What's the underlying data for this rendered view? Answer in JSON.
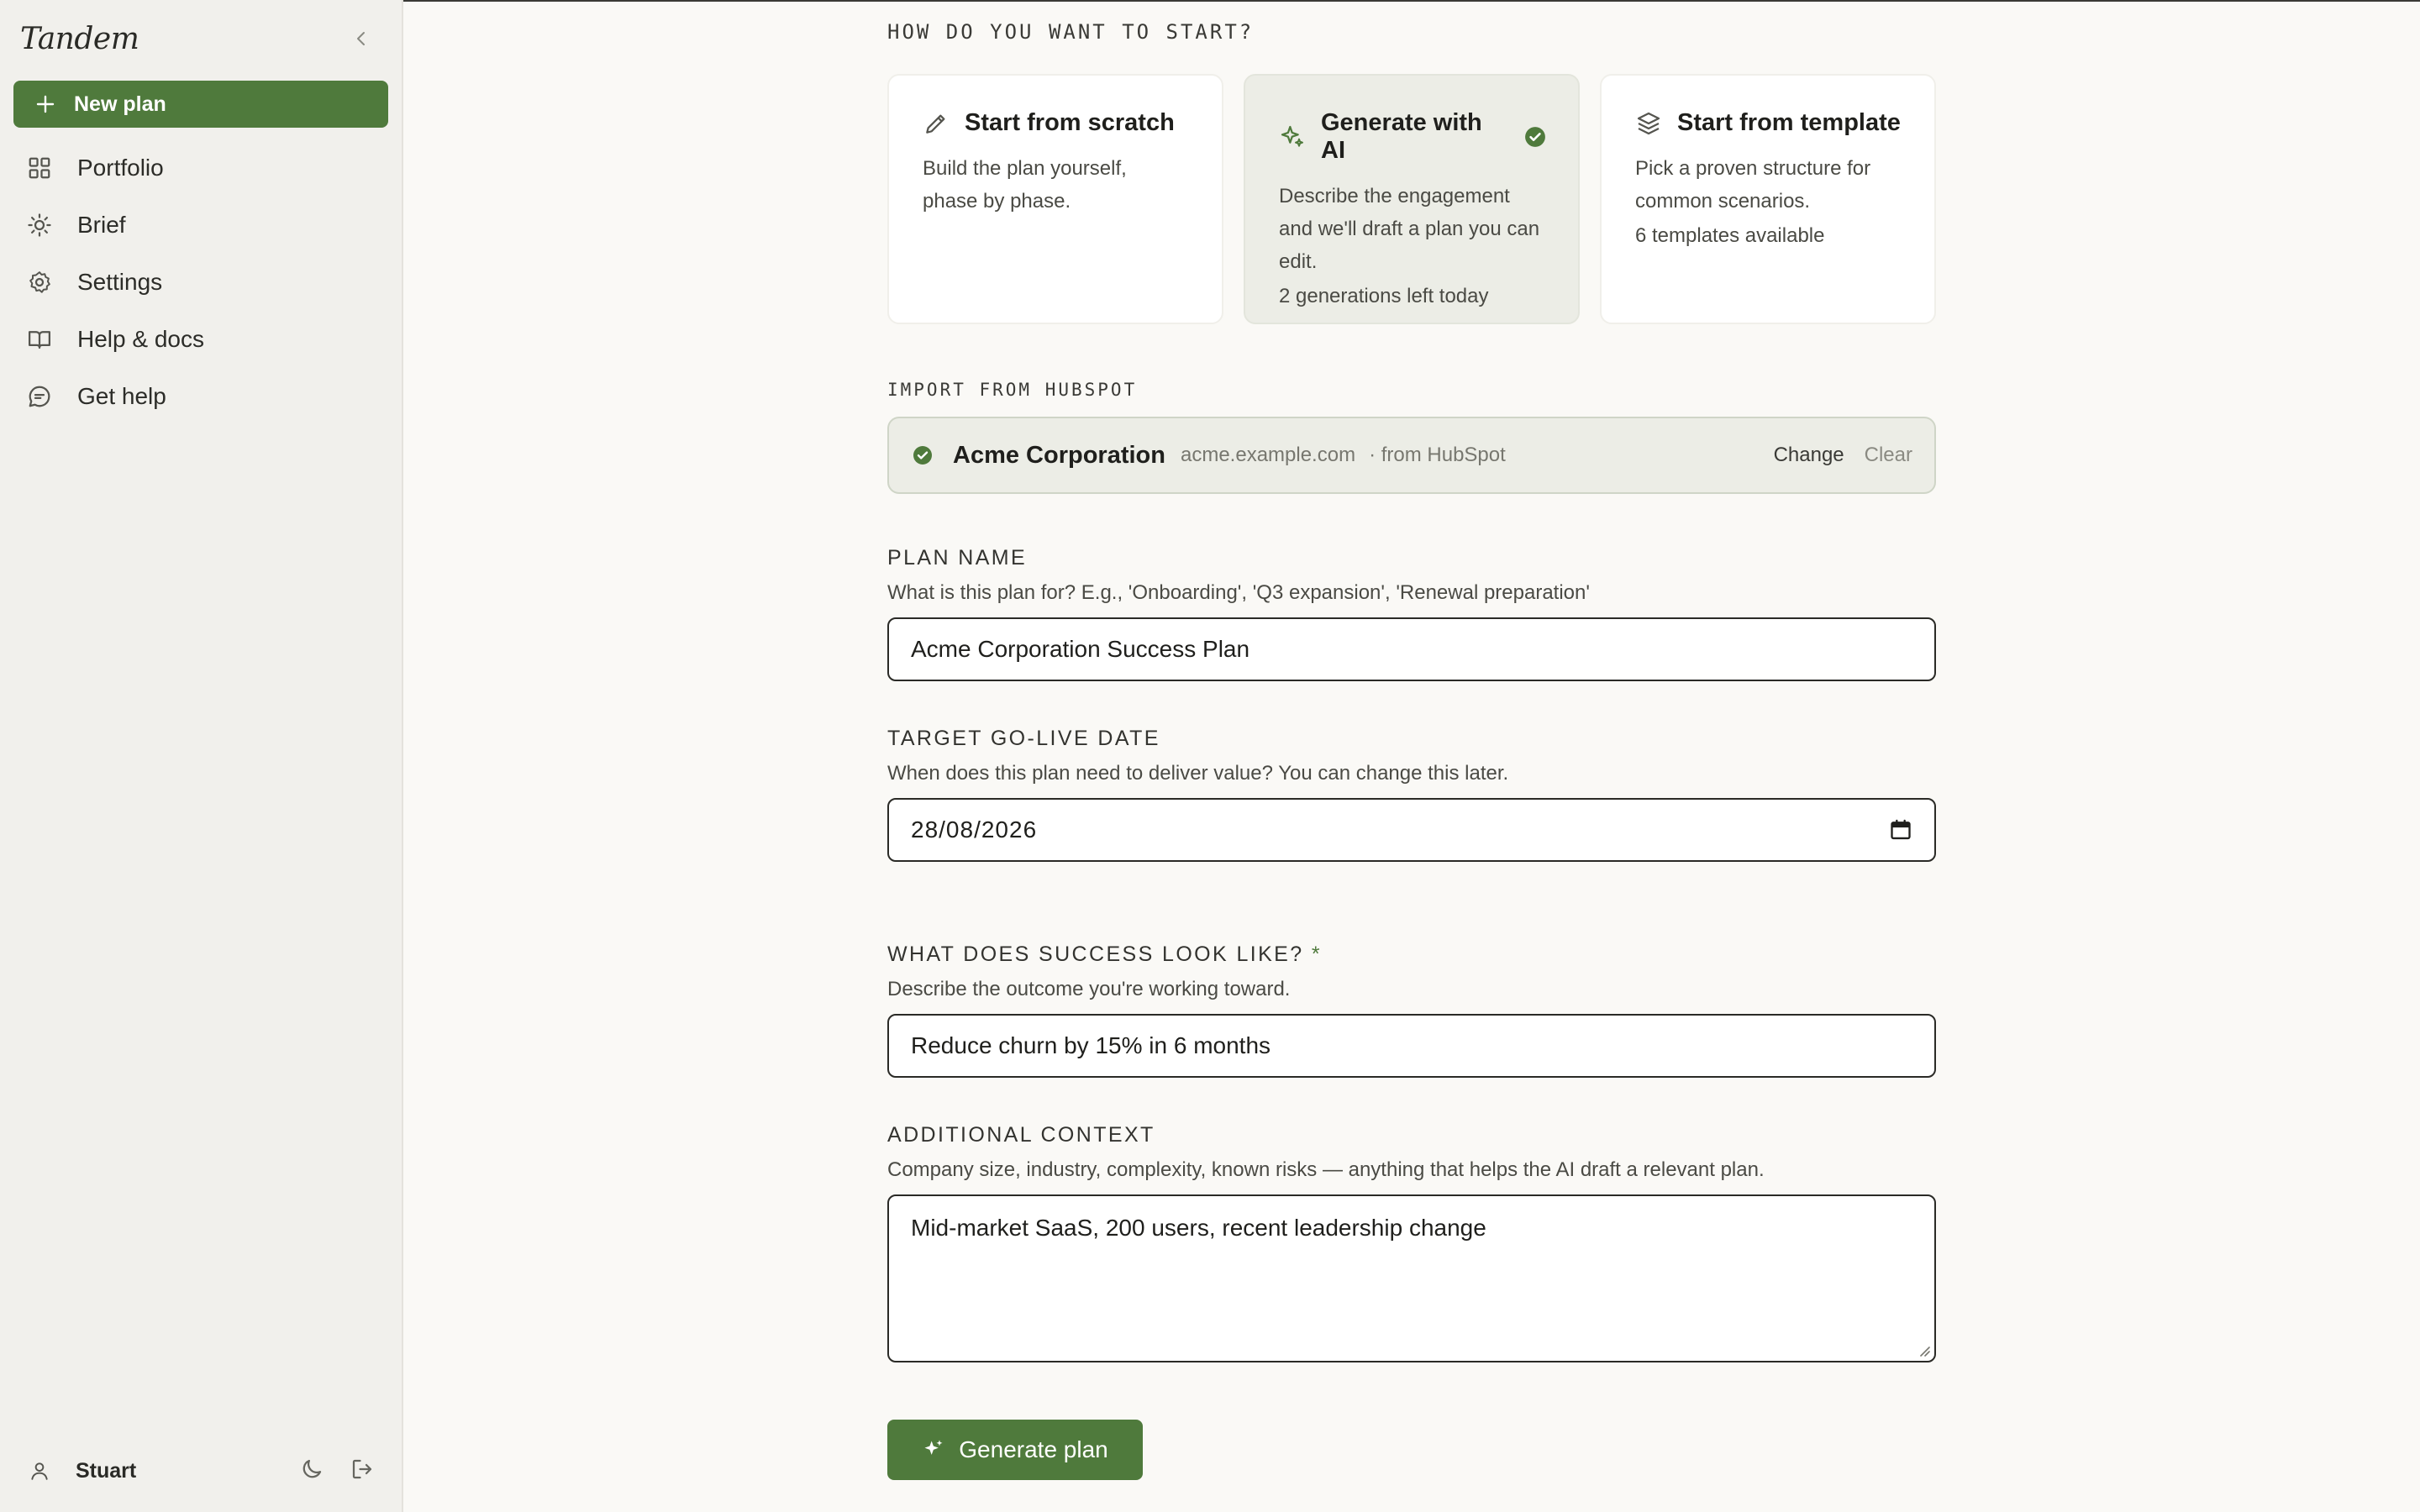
{
  "app": {
    "brand": "Tandem"
  },
  "sidebar": {
    "new_plan_label": "New plan",
    "items": [
      {
        "label": "Portfolio",
        "icon": "grid-icon"
      },
      {
        "label": "Brief",
        "icon": "sun-icon"
      },
      {
        "label": "Settings",
        "icon": "gear-icon"
      },
      {
        "label": "Help & docs",
        "icon": "book-icon"
      },
      {
        "label": "Get help",
        "icon": "chat-icon"
      }
    ],
    "user": {
      "name": "Stuart"
    }
  },
  "start": {
    "label": "HOW DO YOU WANT TO START?",
    "cards": [
      {
        "title": "Start from scratch",
        "desc": "Build the plan yourself, phase by phase.",
        "meta": "",
        "icon": "pencil-icon"
      },
      {
        "title": "Generate with AI",
        "desc": "Describe the engagement and we'll draft a plan you can edit.",
        "meta": "2 generations left today",
        "icon": "sparkle-icon",
        "selected": true
      },
      {
        "title": "Start from template",
        "desc": "Pick a proven structure for common scenarios.",
        "meta": "6 templates available",
        "icon": "layers-icon"
      }
    ]
  },
  "import": {
    "label": "IMPORT FROM HUBSPOT",
    "company": "Acme Corporation",
    "domain": "acme.example.com",
    "source": "· from HubSpot",
    "change_label": "Change",
    "clear_label": "Clear"
  },
  "form": {
    "plan_name": {
      "label": "PLAN NAME",
      "help": "What is this plan for? E.g., 'Onboarding', 'Q3 expansion', 'Renewal preparation'",
      "value": "Acme Corporation Success Plan"
    },
    "go_live": {
      "label": "TARGET GO-LIVE DATE",
      "help": "When does this plan need to deliver value? You can change this later.",
      "value": "28/08/2026"
    },
    "success": {
      "label": "WHAT DOES SUCCESS LOOK LIKE?",
      "required_mark": "*",
      "help": "Describe the outcome you're working toward.",
      "value": "Reduce churn by 15% in 6 months"
    },
    "context": {
      "label": "ADDITIONAL CONTEXT",
      "help": "Company size, industry, complexity, known risks — anything that helps the AI draft a relevant plan.",
      "value": "Mid-market SaaS, 200 users, recent leadership change"
    },
    "submit_label": "Generate plan"
  },
  "colors": {
    "accent": "#4f7a3c",
    "selected_card": "#ecede6"
  }
}
